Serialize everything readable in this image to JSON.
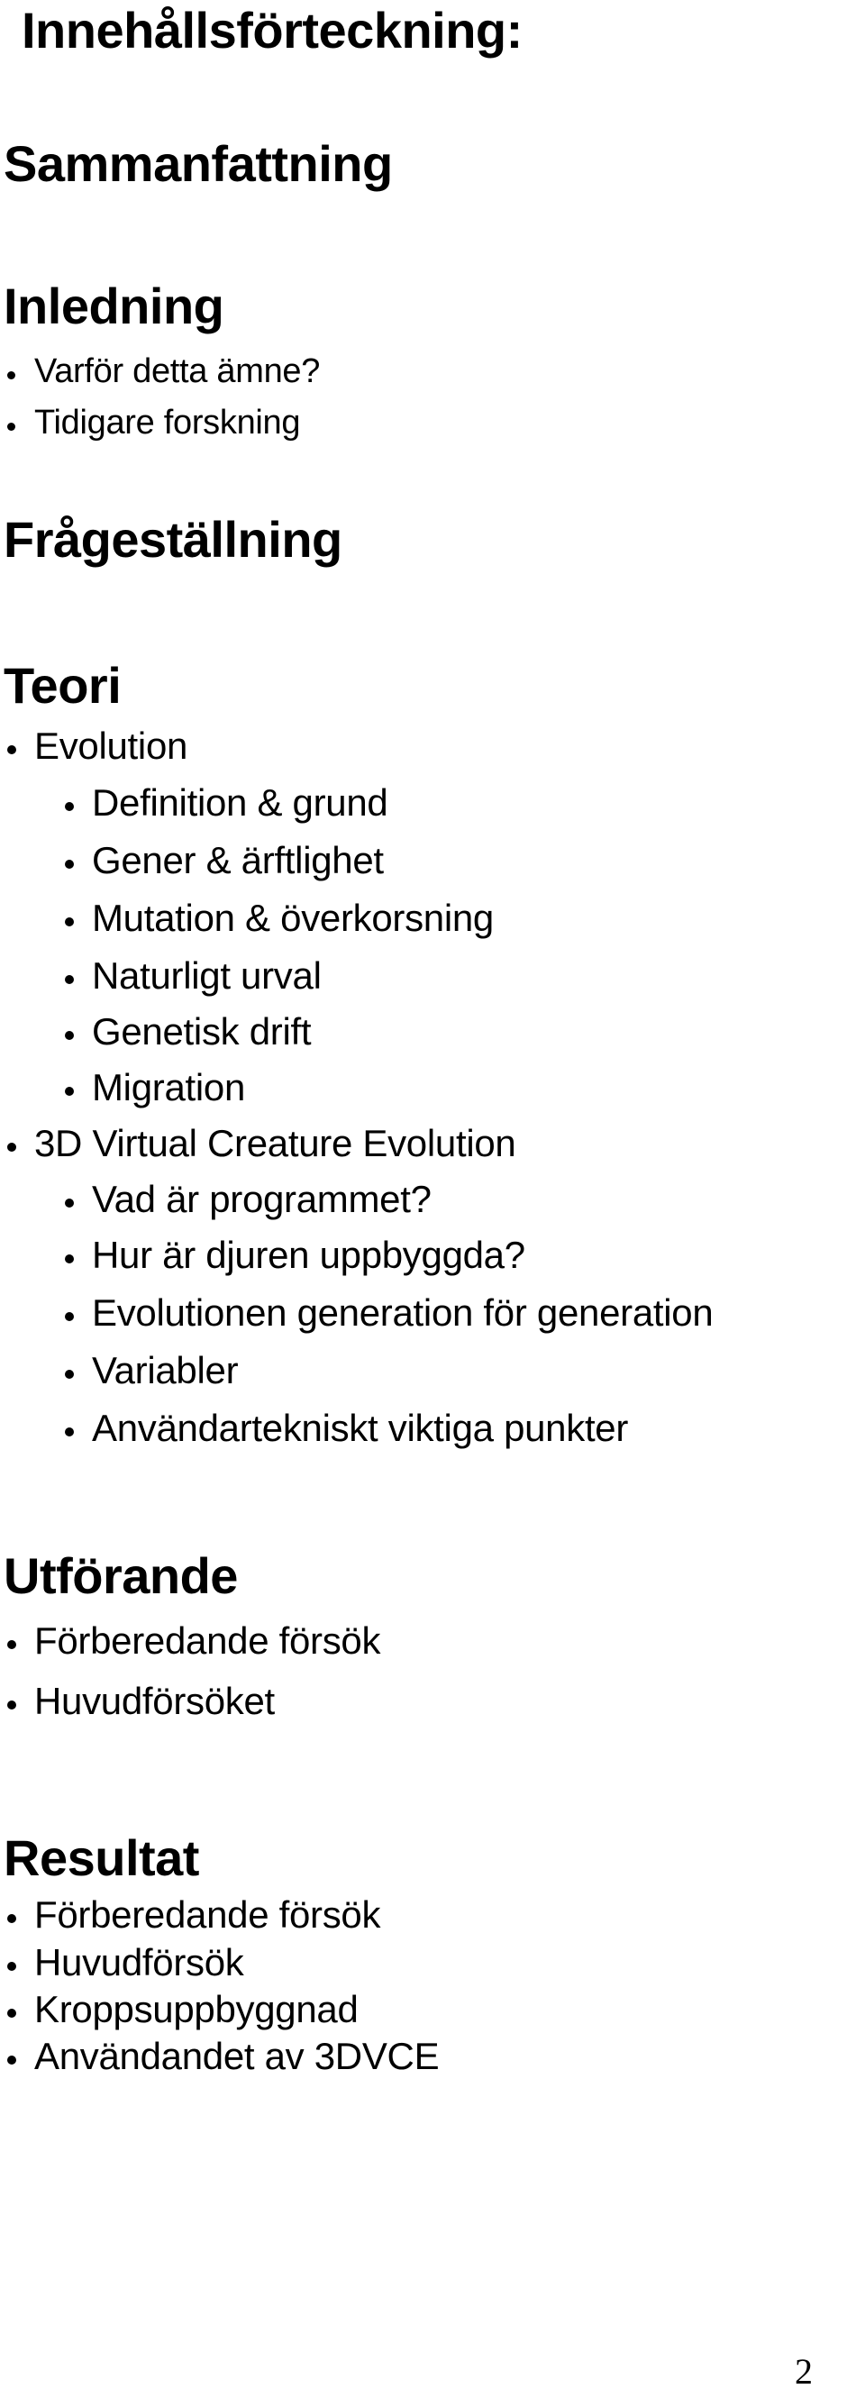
{
  "document": {
    "title": "Innehållsförteckning:",
    "page_number": "2"
  },
  "sections": {
    "sammanfattning": {
      "heading": "Sammanfattning"
    },
    "inledning": {
      "heading": "Inledning",
      "items": [
        "Varför detta ämne?",
        "Tidigare forskning"
      ]
    },
    "fragestallning": {
      "heading": "Frågeställning"
    },
    "teori": {
      "heading": "Teori",
      "items": [
        {
          "label": "Evolution",
          "children": [
            "Definition & grund",
            "Gener & ärftlighet",
            "Mutation & överkorsning",
            "Naturligt urval",
            "Genetisk drift",
            "Migration"
          ]
        },
        {
          "label": "3D Virtual Creature Evolution",
          "children": [
            "Vad är programmet?",
            "Hur är djuren uppbyggda?",
            "Evolutionen generation för generation",
            "Variabler",
            "Användartekniskt viktiga punkter"
          ]
        }
      ]
    },
    "utforande": {
      "heading": "Utförande",
      "items": [
        "Förberedande försök",
        "Huvudförsöket"
      ]
    },
    "resultat": {
      "heading": "Resultat",
      "items": [
        "Förberedande försök",
        "Huvudförsök",
        "Kroppsuppbyggnad",
        "Användandet av 3DVCE"
      ]
    }
  }
}
